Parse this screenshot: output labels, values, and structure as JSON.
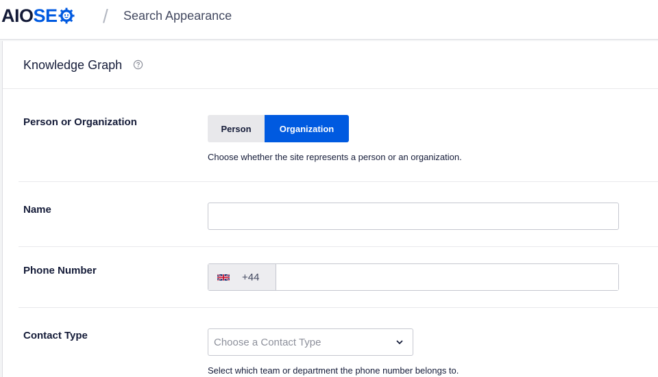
{
  "header": {
    "logo_aio": "AIO",
    "logo_seo": "SE",
    "brand_color": "#005ae0",
    "separator": "/",
    "page_title": "Search Appearance"
  },
  "section": {
    "title": "Knowledge Graph",
    "help_icon": "question-circle-icon"
  },
  "person_or_org": {
    "label": "Person or Organization",
    "options": [
      "Person",
      "Organization"
    ],
    "selected": "Organization",
    "description": "Choose whether the site represents a person or an organization."
  },
  "name": {
    "label": "Name",
    "value": "",
    "placeholder": ""
  },
  "phone": {
    "label": "Phone Number",
    "country_flag": "uk-flag-icon",
    "country_code": "+44",
    "value": ""
  },
  "contact_type": {
    "label": "Contact Type",
    "placeholder": "Choose a Contact Type",
    "description": "Select which team or department the phone number belongs to."
  }
}
